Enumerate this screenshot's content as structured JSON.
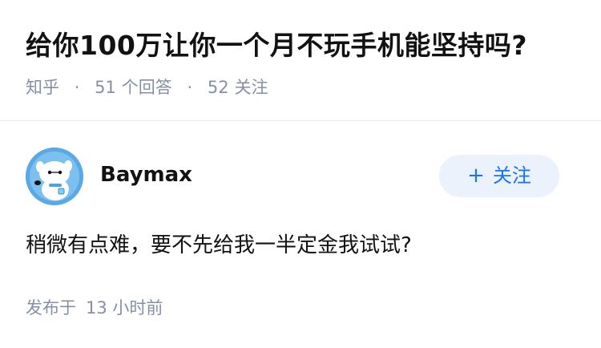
{
  "question": {
    "title": "给你100万让你一个月不玩手机能坚持吗?",
    "source": "知乎",
    "answer_count": "51",
    "answer_label": "个回答",
    "follow_count": "52",
    "follow_label": "关注"
  },
  "answer": {
    "author": {
      "name": "Baymax",
      "avatar_icon": "baymax-avatar-icon"
    },
    "follow_button": {
      "plus": "+",
      "label": "关注"
    },
    "content": "稍微有点难，要不先给我一半定金我试试?",
    "publish_label": "发布于",
    "publish_time": "13 小时前"
  },
  "colors": {
    "text_primary": "#121212",
    "text_secondary": "#8590a6",
    "brand_blue": "#1772f6",
    "follow_bg": "#ebf2fb",
    "avatar_bg": "#5aa9e6"
  }
}
